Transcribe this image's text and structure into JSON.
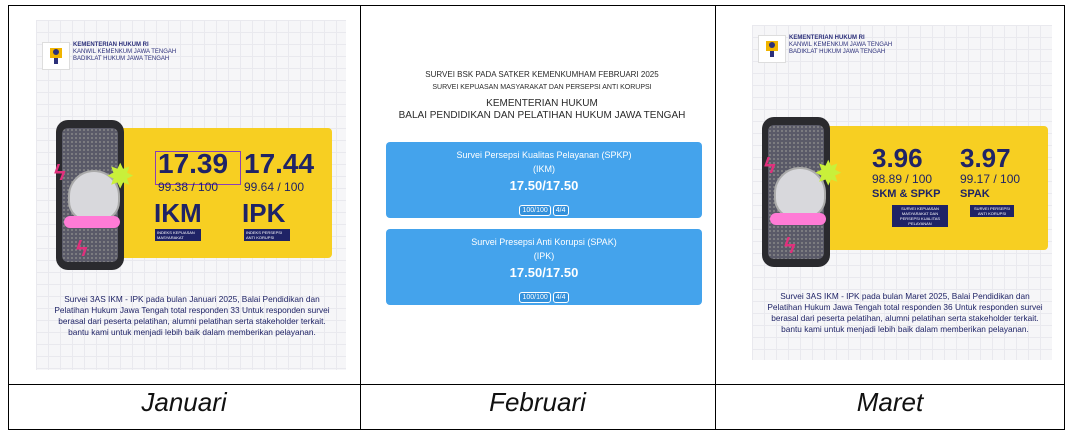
{
  "captions": [
    "Januari",
    "Februari",
    "Maret"
  ],
  "januari": {
    "org": [
      "KEMENTERIAN HUKUM RI",
      "KANWIL KEMENKUM JAWA TENGAH",
      "BADIKLAT HUKUM JAWA TENGAH"
    ],
    "score1": "17.39",
    "sub1": "99.38 / 100",
    "label1": "IKM",
    "tag1": "INDEKS KEPUASAN MASYARAKAT",
    "score2": "17.44",
    "sub2": "99.64 / 100",
    "label2": "IPK",
    "tag2": "INDEKS PERSEPSI ANTI KORUPSI",
    "desc": "Survei 3AS IKM - IPK pada bulan Januari 2025, Balai Pendidikan dan Pelatihan Hukum Jawa Tengah total responden 33 Untuk responden survei berasal dari peserta pelatihan, alumni pelatihan serta stakeholder terkait. bantu kami untuk menjadi lebih baik dalam memberikan pelayanan."
  },
  "februari": {
    "head1": "SURVEI BSK PADA SATKER KEMENKUMHAM FEBRUARI 2025",
    "head2": "SURVEI KEPUASAN MASYARAKAT DAN PERSEPSI ANTI KORUPSI",
    "head3": "KEMENTERIAN HUKUM",
    "head4": "BALAI PENDIDIKAN DAN PELATIHAN HUKUM JAWA TENGAH",
    "card1": {
      "title": "Survei Persepsi Kualitas Pelayanan (SPKP)",
      "code": "(IKM)",
      "score": "17.50/17.50",
      "pill1": "100/100",
      "pill2": "4/4"
    },
    "card2": {
      "title": "Survei Presepsi Anti Korupsi (SPAK)",
      "code": "(IPK)",
      "score": "17.50/17.50",
      "pill1": "100/100",
      "pill2": "4/4"
    }
  },
  "maret": {
    "org": [
      "KEMENTERIAN HUKUM RI",
      "KANWIL KEMENKUM JAWA TENGAH",
      "BADIKLAT HUKUM JAWA TENGAH"
    ],
    "score1": "3.96",
    "sub1": "98.89 / 100",
    "label1": "SKM & SPKP",
    "tag1": "SURVEI KEPUASAN MASYARAKAT DAN PERSEPSI KUALITAS PELAYANAN",
    "score2": "3.97",
    "sub2": "99.17 / 100",
    "label2": "SPAK",
    "tag2": "SURVEI PERSEPSI ANTI KORUPSI",
    "desc": "Survei 3AS IKM - IPK pada bulan Maret 2025, Balai Pendidikan dan Pelatihan Hukum Jawa Tengah total responden 36 Untuk responden survei berasal dari peserta pelatihan, alumni pelatihan serta stakeholder terkait. bantu kami untuk menjadi lebih baik dalam memberikan pelayanan."
  },
  "colors": {
    "yellow": "#f7cf22",
    "navy": "#1f2366",
    "blue": "#44a3ec",
    "pink": "#e0307c",
    "lime": "#c9f03a"
  }
}
